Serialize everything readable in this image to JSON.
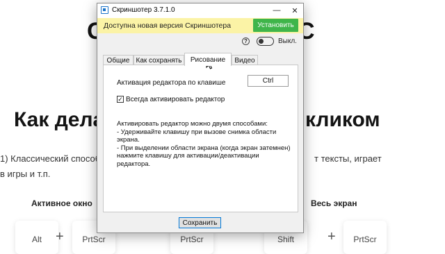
{
  "background_page": {
    "top_heading_left": "С",
    "top_heading_right": "С",
    "heading_left": "Как дела",
    "heading_right": "кликом",
    "para_line1_left": "1) Классический способ",
    "para_line1_right": "т тексты, играет",
    "para_line2": "в игры и т.п.",
    "col_left_label": "Активное окно",
    "col_right_label": "Весь экран",
    "keys": [
      "Alt",
      "PrtScr",
      "PrtScr",
      "Shift",
      "PrtScr"
    ],
    "plus_sign": "+"
  },
  "dialog": {
    "title": "Скриншотер 3.7.1.0",
    "minimize_glyph": "—",
    "close_glyph": "✕",
    "update_text": "Доступна новая версия Скриншотера",
    "update_button": "Установить",
    "help_glyph": "?",
    "toggle_label": "Выкл.",
    "tabs": [
      {
        "label": "Общие",
        "active": false
      },
      {
        "label": "Как сохранять",
        "active": false
      },
      {
        "label": "Рисование",
        "active": true
      },
      {
        "label": "Видео",
        "active": false
      }
    ],
    "hotkey_label": "Активация редактора по клавише",
    "hotkey_value": "Ctrl",
    "checkbox_checked": true,
    "checkbox_mark": "✓",
    "checkbox_label": "Всегда активировать редактор",
    "info_lines": [
      "Активировать редактор можно двумя способами:",
      "- Удерживайте клавишу при вызове снимка области",
      "экрана.",
      "- При выделении области экрана (когда экран затемнен)",
      "нажмите клавишу для активации/деактивации редактора."
    ],
    "save_button": "Сохранить"
  },
  "colors": {
    "update_bar_bg": "#fbf3a6",
    "update_button_bg": "#3fb54a",
    "accent_blue": "#0078d7"
  }
}
